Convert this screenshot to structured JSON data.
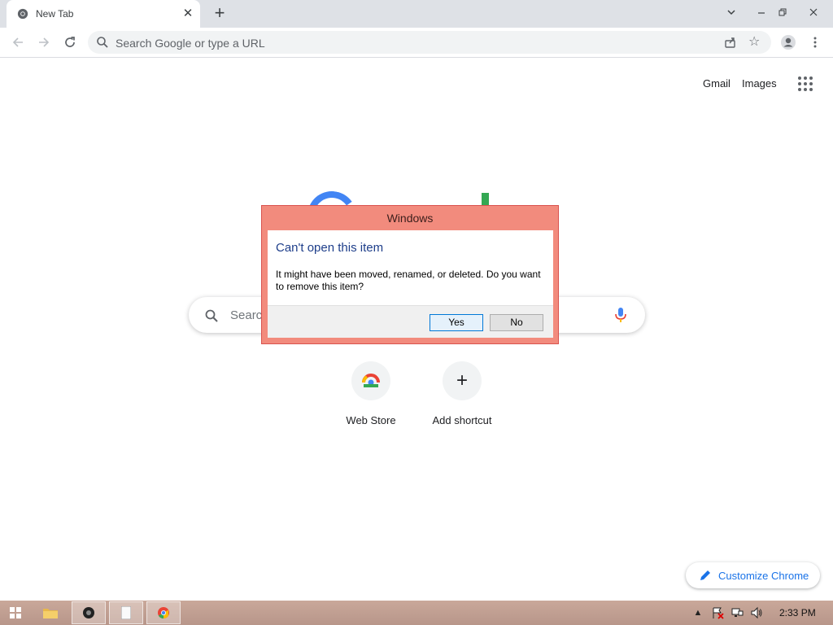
{
  "browser": {
    "tab": {
      "title": "New Tab"
    },
    "new_tab_symbol": "+",
    "omnibox": {
      "placeholder": "Search Google or type a URL"
    }
  },
  "page": {
    "top_links": {
      "gmail": "Gmail",
      "images": "Images"
    },
    "search": {
      "placeholder": "Searc"
    },
    "shortcuts": [
      {
        "label": "Web Store",
        "icon": "web-store-icon"
      },
      {
        "label": "Add shortcut",
        "icon": "plus-icon",
        "symbol": "+"
      }
    ],
    "customize_label": "Customize Chrome"
  },
  "dialog": {
    "window_title": "Windows",
    "heading": "Can't open this item",
    "message": "It might have been moved, renamed, or deleted. Do you want to remove this item?",
    "yes_label": "Yes",
    "no_label": "No",
    "colors": {
      "frame": "#f28b7d",
      "heading": "#1e3e8a"
    }
  },
  "taskbar": {
    "clock": "2:33 PM"
  },
  "colors": {
    "accent": "#1a73e8",
    "tabstrip": "#dee1e6"
  }
}
